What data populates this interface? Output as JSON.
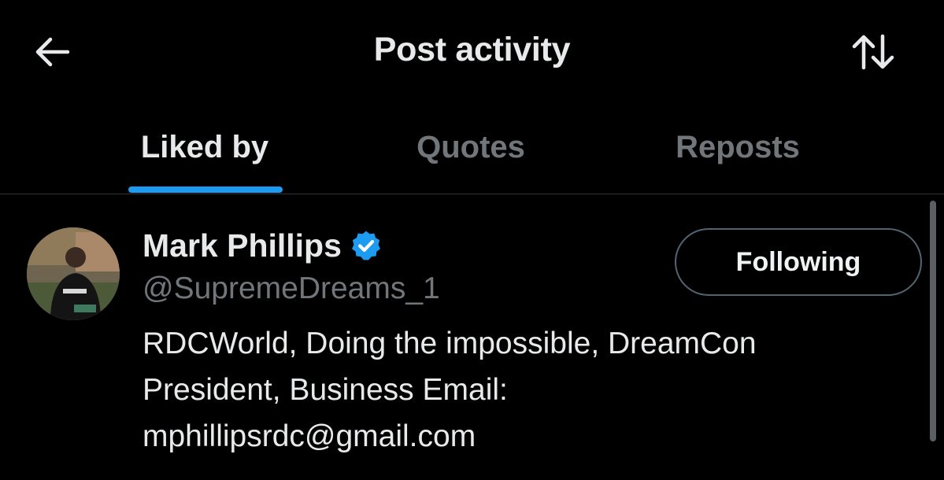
{
  "header": {
    "title": "Post activity",
    "back_icon": "arrow-left-icon",
    "sort_icon": "sort-arrows-icon"
  },
  "tabs": [
    {
      "label": "Liked by",
      "active": true
    },
    {
      "label": "Quotes",
      "active": false
    },
    {
      "label": "Reposts",
      "active": false
    }
  ],
  "users": [
    {
      "name": "Mark Phillips",
      "verified": true,
      "handle": "@SupremeDreams_1",
      "follow_label": "Following",
      "bio_lines": [
        "RDCWorld, Doing the impossible, DreamCon",
        "President, Business Email:",
        "mphillipsrdc@gmail.com"
      ]
    }
  ],
  "colors": {
    "background": "#000000",
    "accent": "#1d9bf0",
    "text_primary": "#e7e9ea",
    "text_secondary": "#71767b",
    "divider": "#2f3336"
  }
}
